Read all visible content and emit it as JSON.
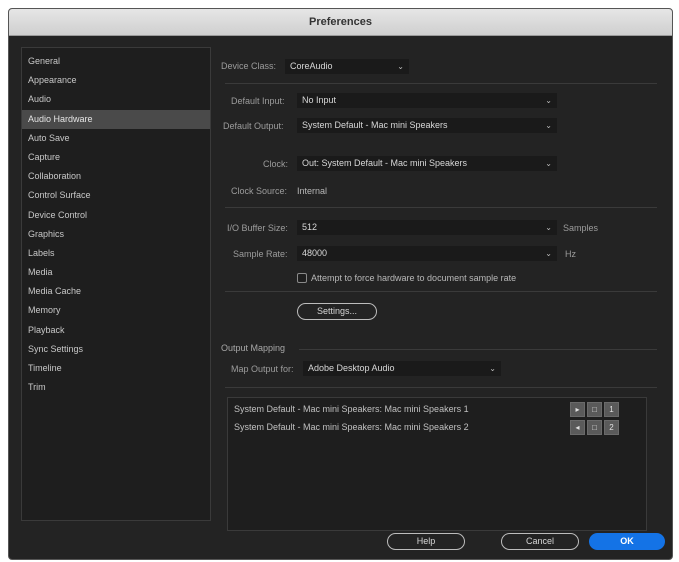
{
  "window": {
    "title": "Preferences"
  },
  "sidebar": {
    "items": [
      {
        "label": "General",
        "selected": false
      },
      {
        "label": "Appearance",
        "selected": false
      },
      {
        "label": "Audio",
        "selected": false
      },
      {
        "label": "Audio Hardware",
        "selected": true
      },
      {
        "label": "Auto Save",
        "selected": false
      },
      {
        "label": "Capture",
        "selected": false
      },
      {
        "label": "Collaboration",
        "selected": false
      },
      {
        "label": "Control Surface",
        "selected": false
      },
      {
        "label": "Device Control",
        "selected": false
      },
      {
        "label": "Graphics",
        "selected": false
      },
      {
        "label": "Labels",
        "selected": false
      },
      {
        "label": "Media",
        "selected": false
      },
      {
        "label": "Media Cache",
        "selected": false
      },
      {
        "label": "Memory",
        "selected": false
      },
      {
        "label": "Playback",
        "selected": false
      },
      {
        "label": "Sync Settings",
        "selected": false
      },
      {
        "label": "Timeline",
        "selected": false
      },
      {
        "label": "Trim",
        "selected": false
      }
    ]
  },
  "hardware": {
    "device_class_label": "Device Class:",
    "device_class_value": "CoreAudio",
    "default_input_label": "Default Input:",
    "default_input_value": "No Input",
    "default_output_label": "Default Output:",
    "default_output_value": "System Default - Mac mini Speakers",
    "clock_label": "Clock:",
    "clock_value": "Out: System Default - Mac mini Speakers",
    "clock_source_label": "Clock Source:",
    "clock_source_value": "Internal",
    "buffer_label": "I/O Buffer Size:",
    "buffer_value": "512",
    "buffer_unit": "Samples",
    "sample_rate_label": "Sample Rate:",
    "sample_rate_value": "48000",
    "sample_rate_unit": "Hz",
    "force_rate_label": "Attempt to force hardware to document sample rate",
    "force_rate_checked": false,
    "settings_button": "Settings..."
  },
  "output_mapping": {
    "section_title": "Output Mapping",
    "map_output_label": "Map Output for:",
    "map_output_value": "Adobe Desktop Audio",
    "rows": [
      {
        "label": "System Default - Mac mini Speakers: Mac mini Speakers 1",
        "channel": "1"
      },
      {
        "label": "System Default - Mac mini Speakers: Mac mini Speakers 2",
        "channel": "2"
      }
    ]
  },
  "footer": {
    "help": "Help",
    "cancel": "Cancel",
    "ok": "OK"
  },
  "colors": {
    "accent": "#1473e6",
    "panel": "#232323",
    "selected": "#4a4a4a"
  }
}
